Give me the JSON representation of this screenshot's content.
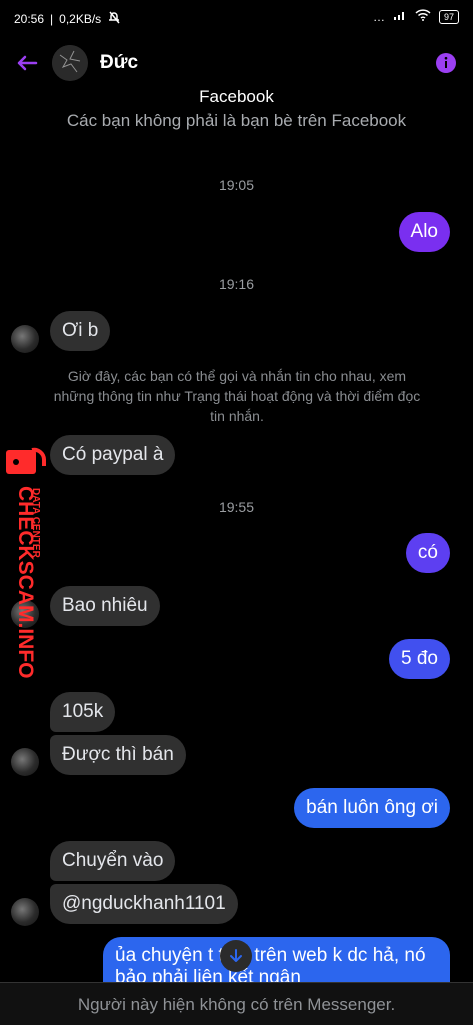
{
  "status": {
    "time": "20:56",
    "speed": "0,2KB/s",
    "battery": "97"
  },
  "header": {
    "contact_name": "Đức"
  },
  "profile": {
    "source": "Facebook",
    "relation": "Các bạn không phải là bạn bè trên Facebook"
  },
  "timestamps": [
    "19:05",
    "19:16",
    "19:55"
  ],
  "notice": "Giờ đây, các bạn có thể gọi và nhắn tin cho nhau, xem những thông tin như Trạng thái hoạt động và thời điểm đọc tin nhắn.",
  "messages": [
    {
      "text": "Alo"
    },
    {
      "text": "Ơi b"
    },
    {
      "text": "Có paypal à"
    },
    {
      "text": "có"
    },
    {
      "text": "Bao nhiêu"
    },
    {
      "text": "5 đo"
    },
    {
      "text": "105k"
    },
    {
      "text": "Được thì bán"
    },
    {
      "text": "bán luôn ông ơi"
    },
    {
      "text": "Chuyển vào"
    },
    {
      "text": "@ngduckhanh1101"
    },
    {
      "text": "ủa chuyện t tiếp trên web k dc hả, nó bảo phải liên kết ngân"
    }
  ],
  "bottom": {
    "text": "Người này hiện không có trên Messenger."
  },
  "watermark": {
    "text": "CHECKSCAM.INFO",
    "subtext": "DATA CENTER"
  },
  "colors": {
    "accent": "#9b3ff2",
    "bubble_purple": "#7a2ff0",
    "bubble_indigo": "#5d3ff1",
    "bubble_blue": "#2c66ee",
    "bubble_in": "#303030",
    "watermark_red": "#ff2b2b"
  }
}
